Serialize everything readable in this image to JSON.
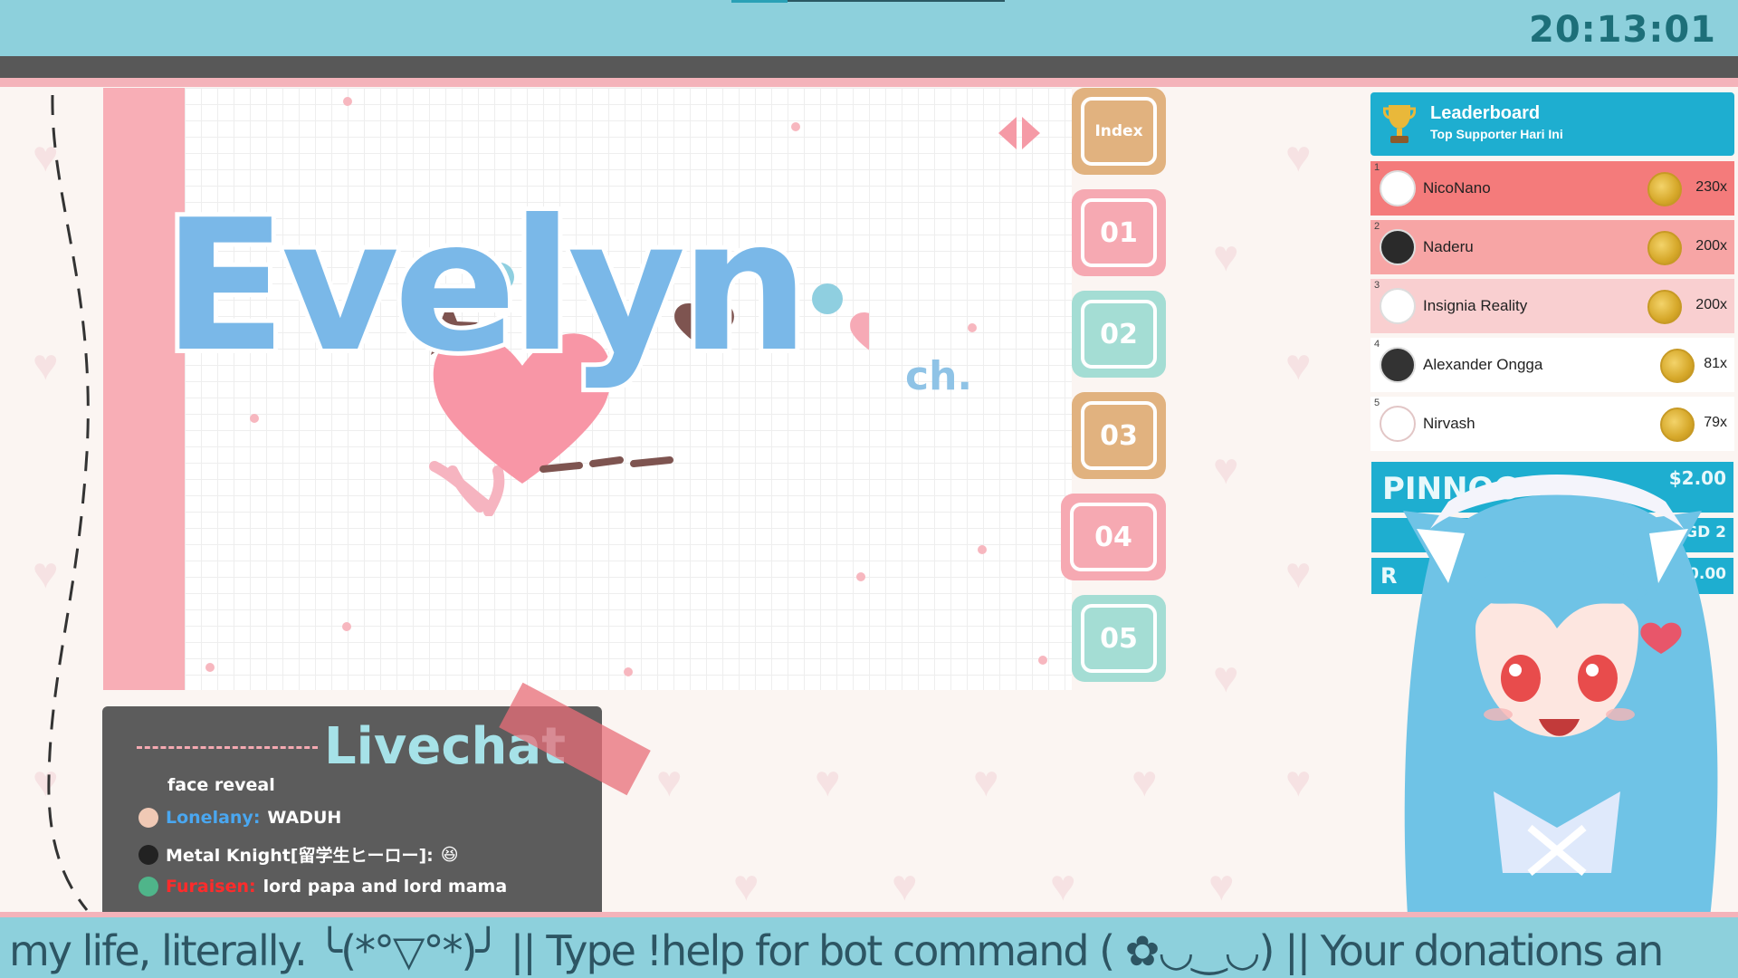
{
  "clock": "20:13:01",
  "logo": {
    "text": "Evelyn",
    "suffix": "ch."
  },
  "tabs": [
    {
      "label": "Index",
      "color": "#e1b27f"
    },
    {
      "label": "01",
      "color": "#f6a9b2"
    },
    {
      "label": "02",
      "color": "#a4ddd4"
    },
    {
      "label": "03",
      "color": "#e1b27f"
    },
    {
      "label": "04",
      "color": "#f6a9b2"
    },
    {
      "label": "05",
      "color": "#a4ddd4"
    }
  ],
  "livechat": {
    "title": "Livechat",
    "messages": [
      {
        "user": "",
        "text": "face reveal",
        "user_color": "#ffffff"
      },
      {
        "user": "Lonelany:",
        "text": "WADUH",
        "user_color": "#4aa7f0"
      },
      {
        "user": "Metal Knight[留学生ヒーロー]:",
        "text": "😆",
        "user_color": "#ffffff"
      },
      {
        "user": "Furaisen:",
        "text": "lord papa and lord mama",
        "user_color": "#ff2b2b"
      }
    ]
  },
  "leaderboard": {
    "title": "Leaderboard",
    "subtitle": "Top Supporter Hari Ini",
    "entries": [
      {
        "rank": "1",
        "name": "NicoNano",
        "count": "230x",
        "bg": "#f47b7b"
      },
      {
        "rank": "2",
        "name": "Naderu",
        "count": "200x",
        "bg": "#f7a5a5"
      },
      {
        "rank": "3",
        "name": "Insignia Reality",
        "count": "200x",
        "bg": "#f9cfd0"
      },
      {
        "rank": "4",
        "name": "Alexander Ongga",
        "count": "81x",
        "bg": "#ffffff"
      },
      {
        "rank": "5",
        "name": "Nirvash",
        "count": "79x",
        "bg": "#ffffff"
      }
    ]
  },
  "pinned": {
    "name": "PINNOC",
    "amount": "$2.00",
    "line2": "SGD 2",
    "line3_left": "R",
    "line3_right": "0.00"
  },
  "ticker": "my life, literally.  ╰(*°▽°*)╯  ||  Type !help for bot command ( ✿◡‿◡)  ||  Your donations an"
}
